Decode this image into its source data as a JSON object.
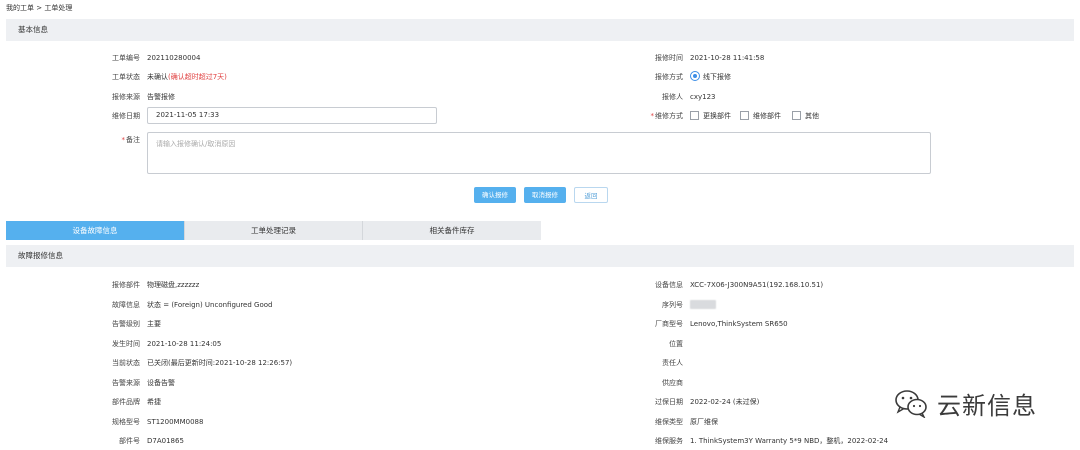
{
  "breadcrumb": {
    "root": "我的工单",
    "separator": ">",
    "current": "工单处理"
  },
  "basic_info": {
    "header": "基本信息",
    "ticket_no_label": "工单编号",
    "ticket_no": "202110280004",
    "status_label": "工单状态",
    "status_prefix": "未确认",
    "status_warning": "(确认超时超过7天)",
    "source_label": "报修来源",
    "source": "告警报修",
    "repair_date_label": "维修日期",
    "repair_date": "2021-11-05 17:33",
    "remark_label": "备注",
    "remark_placeholder": "请输入报修确认/取消原因",
    "report_time_label": "报修时间",
    "report_time": "2021-10-28 11:41:58",
    "report_method_label": "报修方式",
    "report_method": "线下报修",
    "reporter_label": "报修人",
    "reporter": "cxy123",
    "repair_mode_label": "维修方式",
    "repair_modes": [
      "更换部件",
      "维修部件",
      "其他"
    ],
    "buttons": {
      "confirm": "确认报修",
      "cancel": "取消报修",
      "back": "返回"
    }
  },
  "tabs": [
    {
      "label": "设备故障信息",
      "active": true
    },
    {
      "label": "工单处理记录",
      "active": false
    },
    {
      "label": "相关备件库存",
      "active": false
    }
  ],
  "fault_info": {
    "header": "故障报修信息",
    "left": [
      {
        "label": "报修部件",
        "value": "物理磁盘,zzzzzz"
      },
      {
        "label": "故障信息",
        "value": "状态 = (Foreign) Unconfigured Good"
      },
      {
        "label": "告警级别",
        "value": "主要"
      },
      {
        "label": "发生时间",
        "value": "2021-10-28 11:24:05"
      },
      {
        "label": "当前状态",
        "value": "已关闭(最后更新时间:2021-10-28 12:26:57)"
      },
      {
        "label": "告警来源",
        "value": "设备告警"
      },
      {
        "label": "部件品牌",
        "value": "希捷"
      },
      {
        "label": "规格型号",
        "value": "ST1200MM0088"
      },
      {
        "label": "部件号",
        "value": "D7A01865"
      }
    ],
    "right": [
      {
        "label": "设备信息",
        "value": "XCC-7X06-J300N9A51(192.168.10.51)"
      },
      {
        "label": "序列号",
        "value": ""
      },
      {
        "label": "厂商型号",
        "value": "Lenovo,ThinkSystem SR650"
      },
      {
        "label": "位置",
        "value": ""
      },
      {
        "label": "责任人",
        "value": ""
      },
      {
        "label": "供应商",
        "value": ""
      },
      {
        "label": "过保日期",
        "value": "2022-02-24 (未过保)"
      },
      {
        "label": "维保类型",
        "value": "原厂维保"
      },
      {
        "label": "维保服务",
        "value": "1. ThinkSystem3Y Warranty 5*9 NBD，整机，2022-02-24"
      }
    ]
  },
  "watermark": {
    "text": "云新信息",
    "icon": "wechat-icon"
  },
  "colors": {
    "primary": "#55b0ee",
    "danger": "#e04040",
    "header_bg": "#eef0f3"
  }
}
